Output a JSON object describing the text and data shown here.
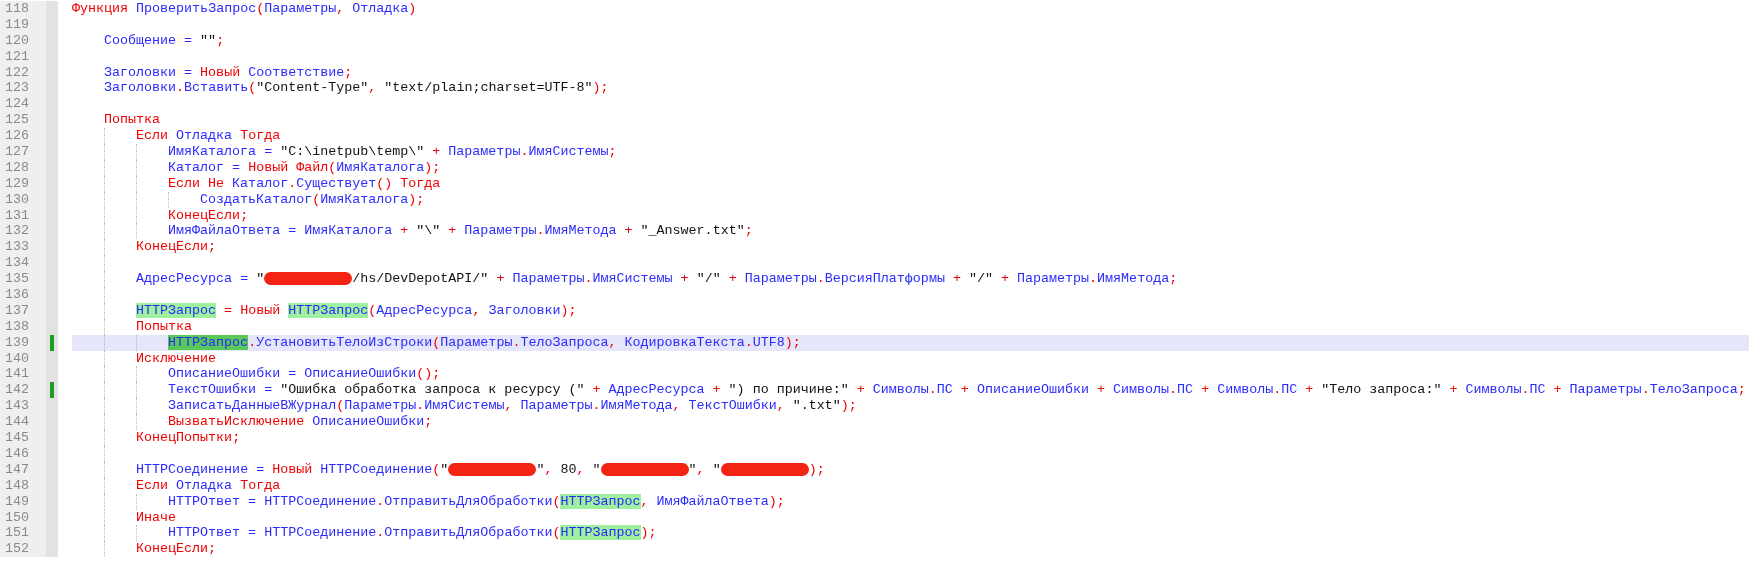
{
  "editor": {
    "lines": [
      {
        "number": "118",
        "current": false,
        "changed": false,
        "tokens": [
          {
            "kind": "keyword",
            "text": "Функция "
          },
          {
            "kind": "name",
            "text": "ПроверитьЗапрос"
          },
          {
            "kind": "punct",
            "text": "("
          },
          {
            "kind": "name",
            "text": "Параметры"
          },
          {
            "kind": "punct",
            "text": ", "
          },
          {
            "kind": "name",
            "text": "Отладка"
          },
          {
            "kind": "punct",
            "text": ")"
          }
        ],
        "children": [
          {
            "number": "119",
            "current": false,
            "changed": false
          },
          {
            "number": "120",
            "current": false,
            "changed": false,
            "tokens": [
              {
                "kind": "name",
                "text": "Сообщение = "
              },
              {
                "kind": "string",
                "text": "\"\""
              },
              {
                "kind": "punct",
                "text": ";"
              }
            ]
          },
          {
            "number": "121",
            "current": false,
            "changed": false
          },
          {
            "number": "122",
            "current": false,
            "changed": false,
            "tokens": [
              {
                "kind": "name",
                "text": "Заголовки = "
              },
              {
                "kind": "keyword",
                "text": "Новый "
              },
              {
                "kind": "name",
                "text": "Соответствие"
              },
              {
                "kind": "punct",
                "text": ";"
              }
            ]
          },
          {
            "number": "123",
            "current": false,
            "changed": false,
            "tokens": [
              {
                "kind": "name",
                "text": "Заголовки"
              },
              {
                "kind": "punct",
                "text": "."
              },
              {
                "kind": "name",
                "text": "Вставить"
              },
              {
                "kind": "punct",
                "text": "("
              },
              {
                "kind": "string",
                "text": "\"Content-Type\""
              },
              {
                "kind": "punct",
                "text": ", "
              },
              {
                "kind": "string",
                "text": "\"text/plain;charset=UTF-8\""
              },
              {
                "kind": "punct",
                "text": ");"
              }
            ]
          },
          {
            "number": "124",
            "current": false,
            "changed": false
          },
          {
            "number": "125",
            "current": false,
            "changed": false,
            "tokens": [
              {
                "kind": "keyword",
                "text": "Попытка"
              }
            ],
            "children": [
              {
                "number": "126",
                "current": false,
                "changed": false,
                "tokens": [
                  {
                    "kind": "keyword",
                    "text": "Если "
                  },
                  {
                    "kind": "name",
                    "text": "Отладка "
                  },
                  {
                    "kind": "keyword",
                    "text": "Тогда"
                  }
                ],
                "children": [
                  {
                    "number": "127",
                    "current": false,
                    "changed": false,
                    "tokens": [
                      {
                        "kind": "name",
                        "text": "ИмяКаталога = "
                      },
                      {
                        "kind": "string",
                        "text": "\"C:\\inetpub\\temp\\\""
                      },
                      {
                        "kind": "punct",
                        "text": " + "
                      },
                      {
                        "kind": "name",
                        "text": "Параметры"
                      },
                      {
                        "kind": "punct",
                        "text": "."
                      },
                      {
                        "kind": "name",
                        "text": "ИмяСистемы"
                      },
                      {
                        "kind": "punct",
                        "text": ";"
                      }
                    ]
                  },
                  {
                    "number": "128",
                    "current": false,
                    "changed": false,
                    "tokens": [
                      {
                        "kind": "name",
                        "text": "Каталог = "
                      },
                      {
                        "kind": "keyword",
                        "text": "Новый Файл"
                      },
                      {
                        "kind": "punct",
                        "text": "("
                      },
                      {
                        "kind": "name",
                        "text": "ИмяКаталога"
                      },
                      {
                        "kind": "punct",
                        "text": ");"
                      }
                    ]
                  },
                  {
                    "number": "129",
                    "current": false,
                    "changed": false,
                    "tokens": [
                      {
                        "kind": "keyword",
                        "text": "Если Не "
                      },
                      {
                        "kind": "name",
                        "text": "Каталог"
                      },
                      {
                        "kind": "punct",
                        "text": "."
                      },
                      {
                        "kind": "name",
                        "text": "Существует"
                      },
                      {
                        "kind": "punct",
                        "text": "() "
                      },
                      {
                        "kind": "keyword",
                        "text": "Тогда"
                      }
                    ],
                    "children": [
                      {
                        "number": "130",
                        "current": false,
                        "changed": false,
                        "tokens": [
                          {
                            "kind": "name",
                            "text": "СоздатьКаталог"
                          },
                          {
                            "kind": "punct",
                            "text": "("
                          },
                          {
                            "kind": "name",
                            "text": "ИмяКаталога"
                          },
                          {
                            "kind": "punct",
                            "text": ");"
                          }
                        ]
                      }
                    ]
                  },
                  {
                    "number": "131",
                    "current": false,
                    "changed": false,
                    "tokens": [
                      {
                        "kind": "keyword",
                        "text": "КонецЕсли"
                      },
                      {
                        "kind": "punct",
                        "text": ";"
                      }
                    ]
                  },
                  {
                    "number": "132",
                    "current": false,
                    "changed": false,
                    "tokens": [
                      {
                        "kind": "name",
                        "text": "ИмяФайлаОтвета = ИмяКаталога"
                      },
                      {
                        "kind": "punct",
                        "text": " + "
                      },
                      {
                        "kind": "string",
                        "text": "\"\\\""
                      },
                      {
                        "kind": "punct",
                        "text": " + "
                      },
                      {
                        "kind": "name",
                        "text": "Параметры"
                      },
                      {
                        "kind": "punct",
                        "text": "."
                      },
                      {
                        "kind": "name",
                        "text": "ИмяМетода"
                      },
                      {
                        "kind": "punct",
                        "text": " + "
                      },
                      {
                        "kind": "string",
                        "text": "\"_Answer.txt\""
                      },
                      {
                        "kind": "punct",
                        "text": ";"
                      }
                    ]
                  }
                ]
              },
              {
                "number": "133",
                "current": false,
                "changed": false,
                "tokens": [
                  {
                    "kind": "keyword",
                    "text": "КонецЕсли"
                  },
                  {
                    "kind": "punct",
                    "text": ";"
                  }
                ]
              },
              {
                "number": "134",
                "current": false,
                "changed": false
              },
              {
                "number": "135",
                "current": false,
                "changed": false,
                "tokens": [
                  {
                    "kind": "name",
                    "text": "АдресРесурса = "
                  },
                  {
                    "kind": "string",
                    "text": "\""
                  },
                  {
                    "kind": "redaction"
                  },
                  {
                    "kind": "string",
                    "text": "/hs/DevDepotAPI/\""
                  },
                  {
                    "kind": "punct",
                    "text": " + "
                  },
                  {
                    "kind": "name",
                    "text": "Параметры"
                  },
                  {
                    "kind": "punct",
                    "text": "."
                  },
                  {
                    "kind": "name",
                    "text": "ИмяСистемы"
                  },
                  {
                    "kind": "punct",
                    "text": " + "
                  },
                  {
                    "kind": "string",
                    "text": "\"/\""
                  },
                  {
                    "kind": "punct",
                    "text": " + "
                  },
                  {
                    "kind": "name",
                    "text": "Параметры"
                  },
                  {
                    "kind": "punct",
                    "text": "."
                  },
                  {
                    "kind": "name",
                    "text": "ВерсияПлатформы"
                  },
                  {
                    "kind": "punct",
                    "text": " + "
                  },
                  {
                    "kind": "string",
                    "text": "\"/\""
                  },
                  {
                    "kind": "punct",
                    "text": " + "
                  },
                  {
                    "kind": "name",
                    "text": "Параметры"
                  },
                  {
                    "kind": "punct",
                    "text": "."
                  },
                  {
                    "kind": "name",
                    "text": "ИмяМетода"
                  },
                  {
                    "kind": "punct",
                    "text": ";"
                  }
                ]
              },
              {
                "number": "136",
                "current": false,
                "changed": false
              },
              {
                "number": "137",
                "current": false,
                "changed": false,
                "tokens": [
                  {
                    "kind": "match",
                    "text": "HTTPЗапрос"
                  },
                  {
                    "kind": "punct",
                    "text": " = "
                  },
                  {
                    "kind": "keyword",
                    "text": "Новый "
                  },
                  {
                    "kind": "match",
                    "text": "HTTPЗапрос"
                  },
                  {
                    "kind": "punct",
                    "text": "("
                  },
                  {
                    "kind": "name",
                    "text": "АдресРесурса"
                  },
                  {
                    "kind": "punct",
                    "text": ", "
                  },
                  {
                    "kind": "name",
                    "text": "Заголовки"
                  },
                  {
                    "kind": "punct",
                    "text": ");"
                  }
                ]
              },
              {
                "number": "138",
                "current": false,
                "changed": false,
                "tokens": [
                  {
                    "kind": "keyword",
                    "text": "Попытка"
                  }
                ],
                "children": [
                  {
                    "number": "139",
                    "current": true,
                    "changed": true,
                    "tokens": [
                      {
                        "kind": "match-current",
                        "text": "HTTPЗапрос"
                      },
                      {
                        "kind": "punct",
                        "text": "."
                      },
                      {
                        "kind": "name",
                        "text": "УстановитьТелоИзСтроки"
                      },
                      {
                        "kind": "punct",
                        "text": "("
                      },
                      {
                        "kind": "name",
                        "text": "Параметры"
                      },
                      {
                        "kind": "punct",
                        "text": "."
                      },
                      {
                        "kind": "name",
                        "text": "ТелоЗапроса"
                      },
                      {
                        "kind": "punct",
                        "text": ", "
                      },
                      {
                        "kind": "name",
                        "text": "КодировкаТекста"
                      },
                      {
                        "kind": "punct",
                        "text": "."
                      },
                      {
                        "kind": "name",
                        "text": "UTF8"
                      },
                      {
                        "kind": "punct",
                        "text": ");"
                      }
                    ]
                  }
                ]
              },
              {
                "number": "140",
                "current": false,
                "changed": false,
                "tokens": [
                  {
                    "kind": "keyword",
                    "text": "Исключение"
                  }
                ],
                "children": [
                  {
                    "number": "141",
                    "current": false,
                    "changed": false,
                    "tokens": [
                      {
                        "kind": "name",
                        "text": "ОписаниеОшибки = ОписаниеОшибки"
                      },
                      {
                        "kind": "punct",
                        "text": "();"
                      }
                    ]
                  },
                  {
                    "number": "142",
                    "current": false,
                    "changed": true,
                    "tokens": [
                      {
                        "kind": "name",
                        "text": "ТекстОшибки = "
                      },
                      {
                        "kind": "string",
                        "text": "\"Ошибка обработка запроса к ресурсу (\""
                      },
                      {
                        "kind": "punct",
                        "text": " + "
                      },
                      {
                        "kind": "name",
                        "text": "АдресРесурса"
                      },
                      {
                        "kind": "punct",
                        "text": " + "
                      },
                      {
                        "kind": "string",
                        "text": "\") по причине:\""
                      },
                      {
                        "kind": "punct",
                        "text": " + "
                      },
                      {
                        "kind": "name",
                        "text": "Символы"
                      },
                      {
                        "kind": "punct",
                        "text": "."
                      },
                      {
                        "kind": "name",
                        "text": "ПС"
                      },
                      {
                        "kind": "punct",
                        "text": " + "
                      },
                      {
                        "kind": "name",
                        "text": "ОписаниеОшибки"
                      },
                      {
                        "kind": "punct",
                        "text": " + "
                      },
                      {
                        "kind": "name",
                        "text": "Символы"
                      },
                      {
                        "kind": "punct",
                        "text": "."
                      },
                      {
                        "kind": "name",
                        "text": "ПС"
                      },
                      {
                        "kind": "punct",
                        "text": " + "
                      },
                      {
                        "kind": "name",
                        "text": "Символы"
                      },
                      {
                        "kind": "punct",
                        "text": "."
                      },
                      {
                        "kind": "name",
                        "text": "ПС"
                      },
                      {
                        "kind": "punct",
                        "text": " + "
                      },
                      {
                        "kind": "string",
                        "text": "\"Тело запроса:\""
                      },
                      {
                        "kind": "punct",
                        "text": " + "
                      },
                      {
                        "kind": "name",
                        "text": "Символы"
                      },
                      {
                        "kind": "punct",
                        "text": "."
                      },
                      {
                        "kind": "name",
                        "text": "ПС"
                      },
                      {
                        "kind": "punct",
                        "text": " + "
                      },
                      {
                        "kind": "name",
                        "text": "Параметры"
                      },
                      {
                        "kind": "punct",
                        "text": "."
                      },
                      {
                        "kind": "name",
                        "text": "ТелоЗапроса"
                      },
                      {
                        "kind": "punct",
                        "text": ";"
                      }
                    ]
                  },
                  {
                    "number": "143",
                    "current": false,
                    "changed": false,
                    "tokens": [
                      {
                        "kind": "name",
                        "text": "ЗаписатьДанныеВЖурнал"
                      },
                      {
                        "kind": "punct",
                        "text": "("
                      },
                      {
                        "kind": "name",
                        "text": "Параметры"
                      },
                      {
                        "kind": "punct",
                        "text": "."
                      },
                      {
                        "kind": "name",
                        "text": "ИмяСистемы"
                      },
                      {
                        "kind": "punct",
                        "text": ", "
                      },
                      {
                        "kind": "name",
                        "text": "Параметры"
                      },
                      {
                        "kind": "punct",
                        "text": "."
                      },
                      {
                        "kind": "name",
                        "text": "ИмяМетода"
                      },
                      {
                        "kind": "punct",
                        "text": ", "
                      },
                      {
                        "kind": "name",
                        "text": "ТекстОшибки"
                      },
                      {
                        "kind": "punct",
                        "text": ", "
                      },
                      {
                        "kind": "string",
                        "text": "\".txt\""
                      },
                      {
                        "kind": "punct",
                        "text": ");"
                      }
                    ]
                  },
                  {
                    "number": "144",
                    "current": false,
                    "changed": false,
                    "tokens": [
                      {
                        "kind": "keyword",
                        "text": "ВызватьИсключение "
                      },
                      {
                        "kind": "name",
                        "text": "ОписаниеОшибки"
                      },
                      {
                        "kind": "punct",
                        "text": ";"
                      }
                    ]
                  }
                ]
              },
              {
                "number": "145",
                "current": false,
                "changed": false,
                "tokens": [
                  {
                    "kind": "keyword",
                    "text": "КонецПопытки"
                  },
                  {
                    "kind": "punct",
                    "text": ";"
                  }
                ]
              },
              {
                "number": "146",
                "current": false,
                "changed": false
              },
              {
                "number": "147",
                "current": false,
                "changed": false,
                "tokens": [
                  {
                    "kind": "name",
                    "text": "HTTPСоединение = "
                  },
                  {
                    "kind": "keyword",
                    "text": "Новый "
                  },
                  {
                    "kind": "name",
                    "text": "HTTPСоединение"
                  },
                  {
                    "kind": "punct",
                    "text": "("
                  },
                  {
                    "kind": "string",
                    "text": "\""
                  },
                  {
                    "kind": "redaction"
                  },
                  {
                    "kind": "string",
                    "text": "\""
                  },
                  {
                    "kind": "punct",
                    "text": ", "
                  },
                  {
                    "kind": "number",
                    "text": "80"
                  },
                  {
                    "kind": "punct",
                    "text": ", "
                  },
                  {
                    "kind": "string",
                    "text": "\""
                  },
                  {
                    "kind": "redaction"
                  },
                  {
                    "kind": "string",
                    "text": "\""
                  },
                  {
                    "kind": "punct",
                    "text": ", "
                  },
                  {
                    "kind": "string",
                    "text": "\""
                  },
                  {
                    "kind": "redaction"
                  },
                  {
                    "kind": "punct",
                    "text": ");"
                  }
                ]
              },
              {
                "number": "148",
                "current": false,
                "changed": false,
                "tokens": [
                  {
                    "kind": "keyword",
                    "text": "Если "
                  },
                  {
                    "kind": "name",
                    "text": "Отладка "
                  },
                  {
                    "kind": "keyword",
                    "text": "Тогда"
                  }
                ],
                "children": [
                  {
                    "number": "149",
                    "current": false,
                    "changed": false,
                    "tokens": [
                      {
                        "kind": "name",
                        "text": "HTTPОтвет = HTTPСоединение"
                      },
                      {
                        "kind": "punct",
                        "text": "."
                      },
                      {
                        "kind": "name",
                        "text": "ОтправитьДляОбработки"
                      },
                      {
                        "kind": "punct",
                        "text": "("
                      },
                      {
                        "kind": "match",
                        "text": "HTTPЗапрос"
                      },
                      {
                        "kind": "punct",
                        "text": ", "
                      },
                      {
                        "kind": "name",
                        "text": "ИмяФайлаОтвета"
                      },
                      {
                        "kind": "punct",
                        "text": ");"
                      }
                    ]
                  }
                ]
              },
              {
                "number": "150",
                "current": false,
                "changed": false,
                "tokens": [
                  {
                    "kind": "keyword",
                    "text": "Иначе"
                  }
                ],
                "children": [
                  {
                    "number": "151",
                    "current": false,
                    "changed": false,
                    "tokens": [
                      {
                        "kind": "name",
                        "text": "HTTPОтвет = HTTPСоединение"
                      },
                      {
                        "kind": "punct",
                        "text": "."
                      },
                      {
                        "kind": "name",
                        "text": "ОтправитьДляОбработки"
                      },
                      {
                        "kind": "punct",
                        "text": "("
                      },
                      {
                        "kind": "match",
                        "text": "HTTPЗапрос"
                      },
                      {
                        "kind": "punct",
                        "text": ");"
                      }
                    ]
                  }
                ]
              },
              {
                "number": "152",
                "current": false,
                "changed": false,
                "tokens": [
                  {
                    "kind": "keyword",
                    "text": "КонецЕсли"
                  },
                  {
                    "kind": "punct",
                    "text": ";"
                  }
                ]
              }
            ]
          }
        ]
      }
    ]
  }
}
